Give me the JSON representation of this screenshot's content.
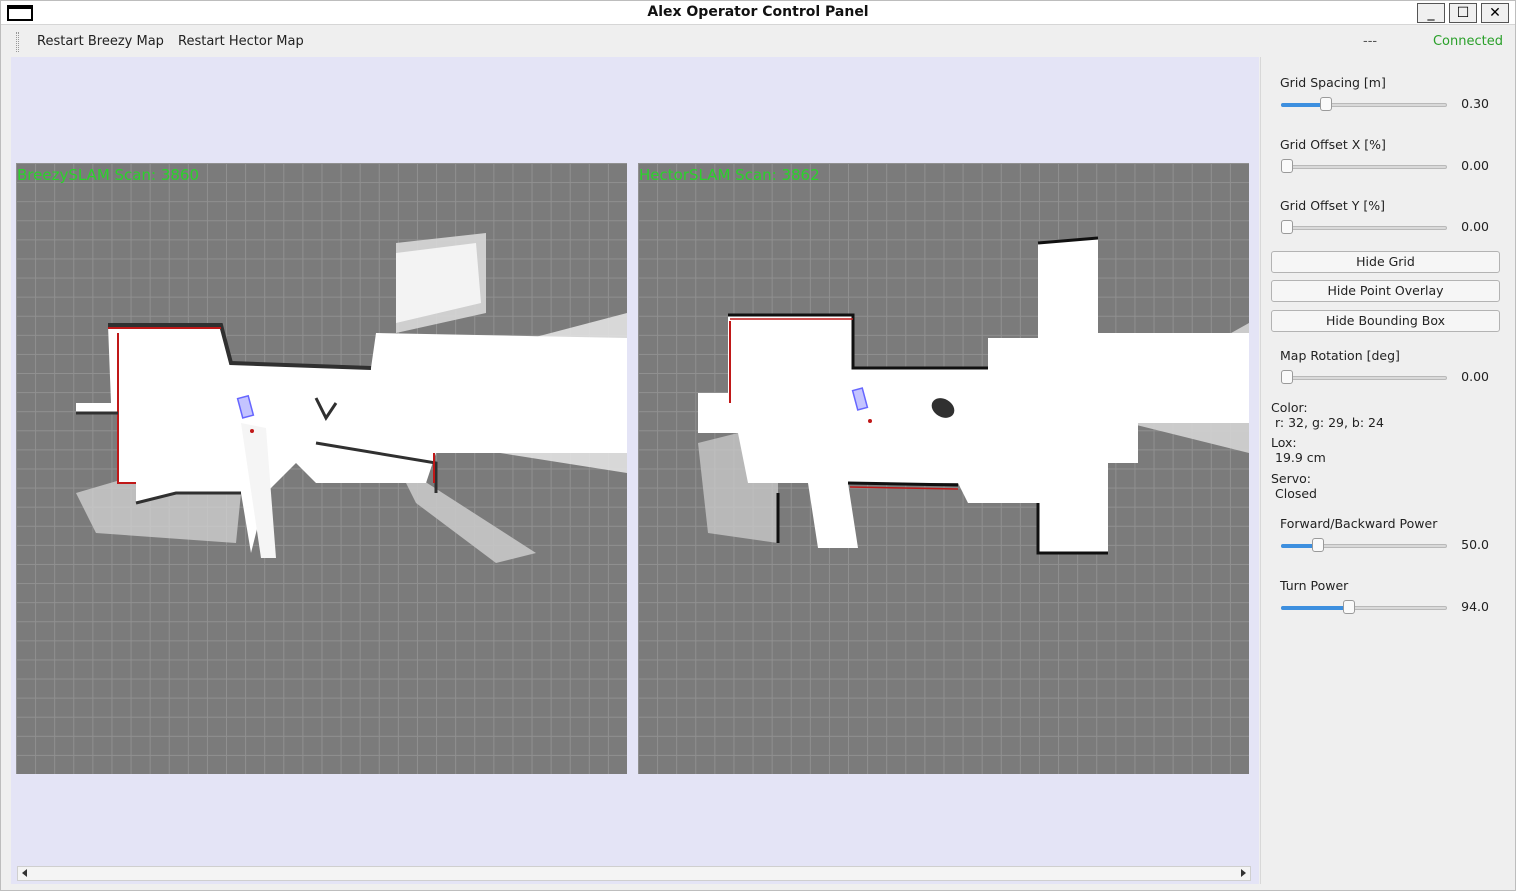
{
  "window": {
    "title": "Alex Operator Control Panel",
    "min": "_",
    "max": "☐",
    "close": "✕"
  },
  "toolbar": {
    "restart_breezy": "Restart Breezy Map",
    "restart_hector": "Restart Hector Map",
    "status_dash": "---",
    "connection": "Connected"
  },
  "maps": {
    "left": {
      "label": "BreezySLAM Scan: 3860"
    },
    "right": {
      "label": "HectorSLAM Scan: 3862"
    }
  },
  "panel": {
    "grid_spacing": {
      "label": "Grid Spacing [m]",
      "value": "0.30",
      "fraction": 0.25
    },
    "grid_offset_x": {
      "label": "Grid Offset X [%]",
      "value": "0.00",
      "fraction": 0
    },
    "grid_offset_y": {
      "label": "Grid Offset Y [%]",
      "value": "0.00",
      "fraction": 0
    },
    "hide_grid": "Hide Grid",
    "hide_point_overlay": "Hide Point Overlay",
    "hide_bounding_box": "Hide Bounding Box",
    "map_rotation": {
      "label": "Map Rotation [deg]",
      "value": "0.00",
      "fraction": 0
    },
    "color": {
      "label": "Color:",
      "value": "r: 32, g: 29, b: 24"
    },
    "lox": {
      "label": "Lox:",
      "value": "19.9 cm"
    },
    "servo": {
      "label": "Servo:",
      "value": "Closed"
    },
    "fb_power": {
      "label": "Forward/Backward Power",
      "value": "50.0",
      "fraction": 0.2
    },
    "turn_power": {
      "label": "Turn Power",
      "value": "94.0",
      "fraction": 0.4
    }
  },
  "colors": {
    "accent": "#3d8fdf",
    "connected": "#2aa02a",
    "map_label": "#2bd22b",
    "main_bg": "#e4e4f6"
  }
}
